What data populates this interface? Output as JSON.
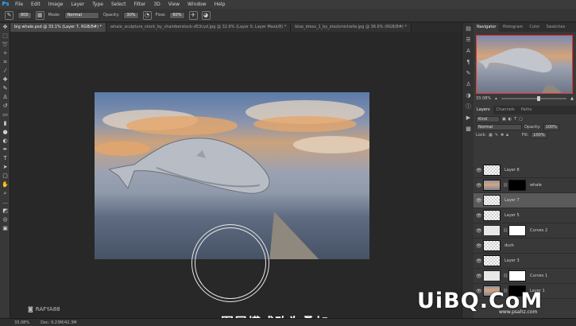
{
  "app": {
    "logo": "Ps"
  },
  "menu": [
    "File",
    "Edit",
    "Image",
    "Layer",
    "Type",
    "Select",
    "Filter",
    "3D",
    "View",
    "Window",
    "Help"
  ],
  "options": {
    "brush_size": "800",
    "mode_label": "Mode:",
    "mode_value": "Normal",
    "opacity_label": "Opacity:",
    "opacity_value": "30%",
    "flow_label": "Flow:",
    "flow_value": "60%"
  },
  "tabs": [
    {
      "label": "big whale.psd @ 33.1% (Layer 7, RGB/8#) *",
      "active": true
    },
    {
      "label": "whale_sculpture_stock_by_chamberstock-d53cyd.jpg @ 32.6% (Layer 0, Layer Mask/8) *",
      "active": false
    },
    {
      "label": "blue_dress_1_by_stockmichelle.jpg @ 36.6% (RGB/8#) *",
      "active": false
    }
  ],
  "canvas": {
    "watermark": "RAFYA88",
    "subtitle": "图层模式改为叠加"
  },
  "status": {
    "zoom": "33.08%",
    "doc": "Doc: 9.23M/42.3M"
  },
  "navigator": {
    "tabs": [
      "Navigator",
      "Histogram",
      "Color",
      "Swatches"
    ],
    "zoom": "33.08%"
  },
  "layers_panel": {
    "tabs": [
      "Layers",
      "Channels",
      "Paths"
    ],
    "kind": "Kind",
    "blend_mode": "Normal",
    "opacity_label": "Opacity:",
    "opacity_value": "100%",
    "lock_label": "Lock:",
    "fill_label": "Fill:",
    "fill_value": "100%",
    "layers": [
      {
        "name": "Layer 8",
        "thumb": "checker",
        "mask": "",
        "selected": false
      },
      {
        "name": "whale",
        "thumb": "photo",
        "mask": "black",
        "selected": false
      },
      {
        "name": "Layer 7",
        "thumb": "checker",
        "mask": "",
        "selected": true
      },
      {
        "name": "Layer 5",
        "thumb": "checker",
        "mask": "",
        "selected": false
      },
      {
        "name": "Curves 2",
        "thumb": "curve",
        "mask": "white",
        "selected": false
      },
      {
        "name": "duck",
        "thumb": "checker",
        "mask": "",
        "selected": false
      },
      {
        "name": "Layer 3",
        "thumb": "checker",
        "mask": "",
        "selected": false
      },
      {
        "name": "Curves 1",
        "thumb": "curve",
        "mask": "white",
        "selected": false
      },
      {
        "name": "Layer 1",
        "thumb": "photo",
        "mask": "black",
        "selected": false
      }
    ]
  },
  "brand": {
    "logo": "UiBQ.CoM",
    "url": "www.psahz.com"
  }
}
